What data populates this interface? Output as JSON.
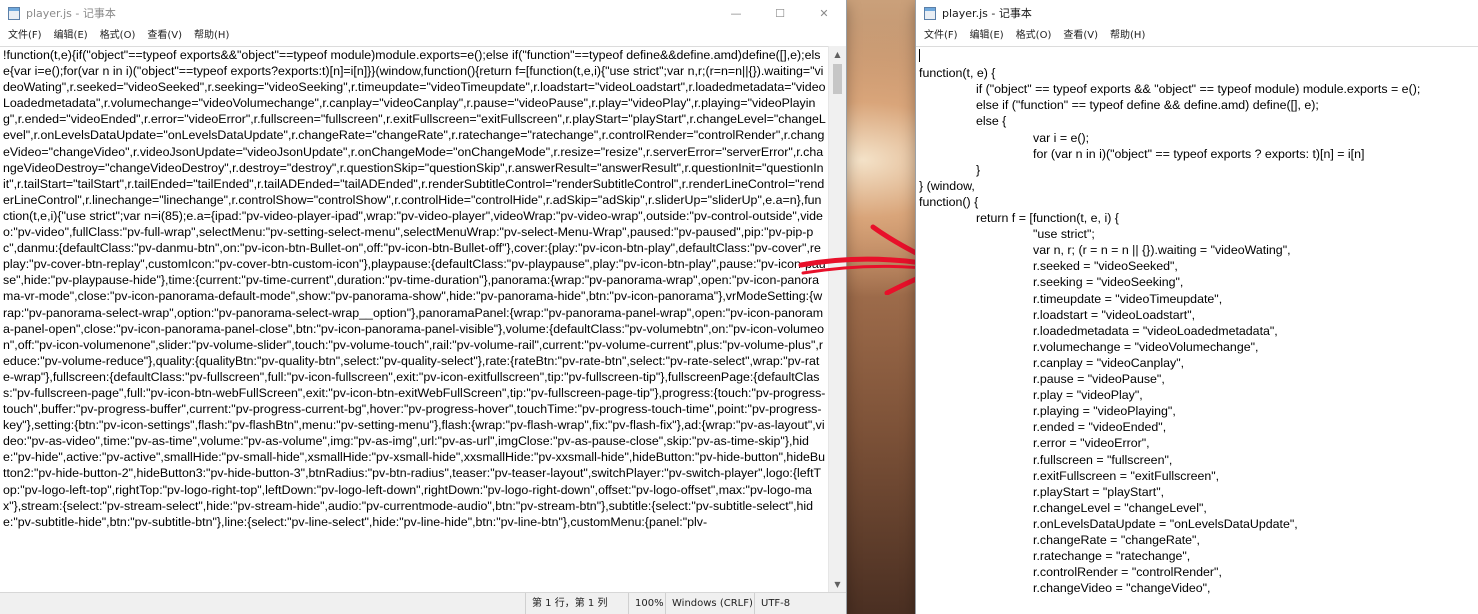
{
  "left_window": {
    "title": "player.js - 记事本",
    "menu": [
      "文件(F)",
      "编辑(E)",
      "格式(O)",
      "查看(V)",
      "帮助(H)"
    ],
    "caption": [
      "—",
      "☐",
      "✕"
    ],
    "code": "!function(t,e){if(\"object\"==typeof exports&&\"object\"==typeof module)module.exports=e();else if(\"function\"==typeof define&&define.amd)define([],e);else{var i=e();for(var n in i)(\"object\"==typeof exports?exports:t)[n]=i[n]}}(window,function(){return f=[function(t,e,i){\"use strict\";var n,r;(r=n=n||{}).waiting=\"videoWating\",r.seeked=\"videoSeeked\",r.seeking=\"videoSeeking\",r.timeupdate=\"videoTimeupdate\",r.loadstart=\"videoLoadstart\",r.loadedmetadata=\"videoLoadedmetadata\",r.volumechange=\"videoVolumechange\",r.canplay=\"videoCanplay\",r.pause=\"videoPause\",r.play=\"videoPlay\",r.playing=\"videoPlaying\",r.ended=\"videoEnded\",r.error=\"videoError\",r.fullscreen=\"fullscreen\",r.exitFullscreen=\"exitFullscreen\",r.playStart=\"playStart\",r.changeLevel=\"changeLevel\",r.onLevelsDataUpdate=\"onLevelsDataUpdate\",r.changeRate=\"changeRate\",r.ratechange=\"ratechange\",r.controlRender=\"controlRender\",r.changeVideo=\"changeVideo\",r.videoJsonUpdate=\"videoJsonUpdate\",r.onChangeMode=\"onChangeMode\",r.resize=\"resize\",r.serverError=\"serverError\",r.changeVideoDestroy=\"changeVideoDestroy\",r.destroy=\"destroy\",r.questionSkip=\"questionSkip\",r.answerResult=\"answerResult\",r.questionInit=\"questionInit\",r.tailStart=\"tailStart\",r.tailEnded=\"tailEnded\",r.tailADEnded=\"tailADEnded\",r.renderSubtitleControl=\"renderSubtitleControl\",r.renderLineControl=\"renderLineControl\",r.linechange=\"linechange\",r.controlShow=\"controlShow\",r.controlHide=\"controlHide\",r.adSkip=\"adSkip\",r.sliderUp=\"sliderUp\",e.a=n},function(t,e,i){\"use strict\";var n=i(85);e.a={ipad:\"pv-video-player-ipad\",wrap:\"pv-video-player\",videoWrap:\"pv-video-wrap\",outside:\"pv-control-outside\",video:\"pv-video\",fullClass:\"pv-full-wrap\",selectMenu:\"pv-setting-select-menu\",selectMenuWrap:\"pv-select-Menu-Wrap\",paused:\"pv-paused\",pip:\"pv-pip-pc\",danmu:{defaultClass:\"pv-danmu-btn\",on:\"pv-icon-btn-Bullet-on\",off:\"pv-icon-btn-Bullet-off\"},cover:{play:\"pv-icon-btn-play\",defaultClass:\"pv-cover\",replay:\"pv-cover-btn-replay\",customIcon:\"pv-cover-btn-custom-icon\"},playpause:{defaultClass:\"pv-playpause\",play:\"pv-icon-btn-play\",pause:\"pv-icon-pause\",hide:\"pv-playpause-hide\"},time:{current:\"pv-time-current\",duration:\"pv-time-duration\"},panorama:{wrap:\"pv-panorama-wrap\",open:\"pv-icon-panorama-vr-mode\",close:\"pv-icon-panorama-default-mode\",show:\"pv-panorama-show\",hide:\"pv-panorama-hide\",btn:\"pv-icon-panorama\"},vrModeSetting:{wrap:\"pv-panorama-select-wrap\",option:\"pv-panorama-select-wrap__option\"},panoramaPanel:{wrap:\"pv-panorama-panel-wrap\",open:\"pv-icon-panorama-panel-open\",close:\"pv-icon-panorama-panel-close\",btn:\"pv-icon-panorama-panel-visible\"},volume:{defaultClass:\"pv-volumebtn\",on:\"pv-icon-volumeon\",off:\"pv-icon-volumenone\",slider:\"pv-volume-slider\",touch:\"pv-volume-touch\",rail:\"pv-volume-rail\",current:\"pv-volume-current\",plus:\"pv-volume-plus\",reduce:\"pv-volume-reduce\"},quality:{qualityBtn:\"pv-quality-btn\",select:\"pv-quality-select\"},rate:{rateBtn:\"pv-rate-btn\",select:\"pv-rate-select\",wrap:\"pv-rate-wrap\"},fullscreen:{defaultClass:\"pv-fullscreen\",full:\"pv-icon-fullscreen\",exit:\"pv-icon-exitfullscreen\",tip:\"pv-fullscreen-tip\"},fullscreenPage:{defaultClass:\"pv-fullscreen-page\",full:\"pv-icon-btn-webFullScreen\",exit:\"pv-icon-btn-exitWebFullScreen\",tip:\"pv-fullscreen-page-tip\"},progress:{touch:\"pv-progress-touch\",buffer:\"pv-progress-buffer\",current:\"pv-progress-current-bg\",hover:\"pv-progress-hover\",touchTime:\"pv-progress-touch-time\",point:\"pv-progress-key\"},setting:{btn:\"pv-icon-settings\",flash:\"pv-flashBtn\",menu:\"pv-setting-menu\"},flash:{wrap:\"pv-flash-wrap\",fix:\"pv-flash-fix\"},ad:{wrap:\"pv-as-layout\",video:\"pv-as-video\",time:\"pv-as-time\",volume:\"pv-as-volume\",img:\"pv-as-img\",url:\"pv-as-url\",imgClose:\"pv-as-pause-close\",skip:\"pv-as-time-skip\"},hide:\"pv-hide\",active:\"pv-active\",smallHide:\"pv-small-hide\",xsmallHide:\"pv-xsmall-hide\",xxsmallHide:\"pv-xxsmall-hide\",hideButton:\"pv-hide-button\",hideButton2:\"pv-hide-button-2\",hideButton3:\"pv-hide-button-3\",btnRadius:\"pv-btn-radius\",teaser:\"pv-teaser-layout\",switchPlayer:\"pv-switch-player\",logo:{leftTop:\"pv-logo-left-top\",rightTop:\"pv-logo-right-top\",leftDown:\"pv-logo-left-down\",rightDown:\"pv-logo-right-down\",offset:\"pv-logo-offset\",max:\"pv-logo-max\"},stream:{select:\"pv-stream-select\",hide:\"pv-stream-hide\",audio:\"pv-currentmode-audio\",btn:\"pv-stream-btn\"},subtitle:{select:\"pv-subtitle-select\",hide:\"pv-subtitle-hide\",btn:\"pv-subtitle-btn\"},line:{select:\"pv-line-select\",hide:\"pv-line-hide\",btn:\"pv-line-btn\"},customMenu:{panel:\"plv-",
    "status": {
      "position": "第 1 行，第 1 列",
      "zoom": "100%",
      "line_ending": "Windows (CRLF)",
      "encoding": "UTF-8"
    }
  },
  "right_window": {
    "title": "player.js - 记事本",
    "menu": [
      "文件(F)",
      "编辑(E)",
      "格式(O)",
      "查看(V)",
      "帮助(H)"
    ],
    "lines": [
      {
        "indent": 0,
        "text": ""
      },
      {
        "indent": 0,
        "text": "function(t, e) {"
      },
      {
        "indent": 1,
        "text": "if (\"object\" == typeof exports && \"object\" == typeof module) module.exports = e();"
      },
      {
        "indent": 1,
        "text": "else if (\"function\" == typeof define && define.amd) define([], e);"
      },
      {
        "indent": 1,
        "text": "else {"
      },
      {
        "indent": 2,
        "text": "var i = e();"
      },
      {
        "indent": 2,
        "text": "for (var n in i)(\"object\" == typeof exports ? exports: t)[n] = i[n]"
      },
      {
        "indent": 1,
        "text": "}"
      },
      {
        "indent": 0,
        "text": "} (window,"
      },
      {
        "indent": 0,
        "text": "function() {"
      },
      {
        "indent": 1,
        "text": "return f = [function(t, e, i) {"
      },
      {
        "indent": 2,
        "text": "\"use strict\";"
      },
      {
        "indent": 2,
        "text": "var n, r; (r = n = n || {}).waiting = \"videoWating\","
      },
      {
        "indent": 2,
        "text": "r.seeked = \"videoSeeked\","
      },
      {
        "indent": 2,
        "text": "r.seeking = \"videoSeeking\","
      },
      {
        "indent": 2,
        "text": "r.timeupdate = \"videoTimeupdate\","
      },
      {
        "indent": 2,
        "text": "r.loadstart = \"videoLoadstart\","
      },
      {
        "indent": 2,
        "text": "r.loadedmetadata = \"videoLoadedmetadata\","
      },
      {
        "indent": 2,
        "text": "r.volumechange = \"videoVolumechange\","
      },
      {
        "indent": 2,
        "text": "r.canplay = \"videoCanplay\","
      },
      {
        "indent": 2,
        "text": "r.pause = \"videoPause\","
      },
      {
        "indent": 2,
        "text": "r.play = \"videoPlay\","
      },
      {
        "indent": 2,
        "text": "r.playing = \"videoPlaying\","
      },
      {
        "indent": 2,
        "text": "r.ended = \"videoEnded\","
      },
      {
        "indent": 2,
        "text": "r.error = \"videoError\","
      },
      {
        "indent": 2,
        "text": "r.fullscreen = \"fullscreen\","
      },
      {
        "indent": 2,
        "text": "r.exitFullscreen = \"exitFullscreen\","
      },
      {
        "indent": 2,
        "text": "r.playStart = \"playStart\","
      },
      {
        "indent": 2,
        "text": "r.changeLevel = \"changeLevel\","
      },
      {
        "indent": 2,
        "text": "r.onLevelsDataUpdate = \"onLevelsDataUpdate\","
      },
      {
        "indent": 2,
        "text": "r.changeRate = \"changeRate\","
      },
      {
        "indent": 2,
        "text": "r.ratechange = \"ratechange\","
      },
      {
        "indent": 2,
        "text": "r.controlRender = \"controlRender\","
      },
      {
        "indent": 2,
        "text": "r.changeVideo = \"changeVideo\","
      }
    ]
  },
  "colors": {
    "annotation_arrow": "#e8102a",
    "status_bar": "#f0f0f0",
    "scrollbar_thumb": "#c6c6c6"
  },
  "icons": {
    "app": "notepad-icon",
    "arrow": "red-hand-drawn-arrow"
  }
}
